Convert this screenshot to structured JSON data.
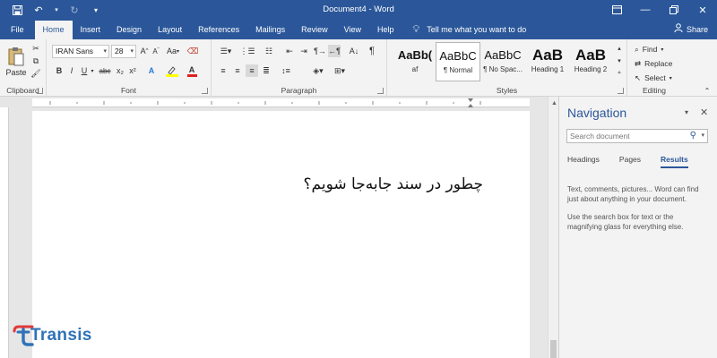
{
  "app": {
    "title": "Document4  -  Word"
  },
  "tabs": [
    "File",
    "Home",
    "Insert",
    "Design",
    "Layout",
    "References",
    "Mailings",
    "Review",
    "View",
    "Help"
  ],
  "tell_me": "Tell me what you want to do",
  "share": "Share",
  "ribbon": {
    "clipboard": {
      "label": "Clipboard",
      "paste": "Paste"
    },
    "font": {
      "label": "Font",
      "name": "IRAN Sans",
      "size": "28",
      "case_label": "Aa",
      "grow": "A",
      "shrink": "A",
      "bold": "B",
      "italic": "I",
      "underline": "U",
      "strike": "abc",
      "sub": "x₂",
      "sup": "x²"
    },
    "paragraph": {
      "label": "Paragraph",
      "pilcrow": "¶"
    },
    "styles": {
      "label": "Styles",
      "items": [
        {
          "sample": "AaBb(",
          "name": "af"
        },
        {
          "sample": "AaBbC",
          "name": "¶ Normal"
        },
        {
          "sample": "AaBbC",
          "name": "¶ No Spac..."
        },
        {
          "sample": "AaB",
          "name": "Heading 1"
        },
        {
          "sample": "AaB",
          "name": "Heading 2"
        }
      ]
    },
    "editing": {
      "label": "Editing",
      "find": "Find",
      "replace": "Replace",
      "select": "Select"
    }
  },
  "document": {
    "text": "چطور در سند جابه‌جا شویم؟"
  },
  "navigation": {
    "title": "Navigation",
    "search_placeholder": "Search document",
    "tabs": [
      "Headings",
      "Pages",
      "Results"
    ],
    "active_tab": "Results",
    "p1": "Text, comments, pictures... Word can find just about anything in your document.",
    "p2": "Use the search box for text or the magnifying glass for everything else."
  },
  "watermark": {
    "brand": "Transis"
  },
  "colors": {
    "brand": "#2b579a",
    "logo": "#2f72b8",
    "logo_accent": "#e03a3a"
  }
}
